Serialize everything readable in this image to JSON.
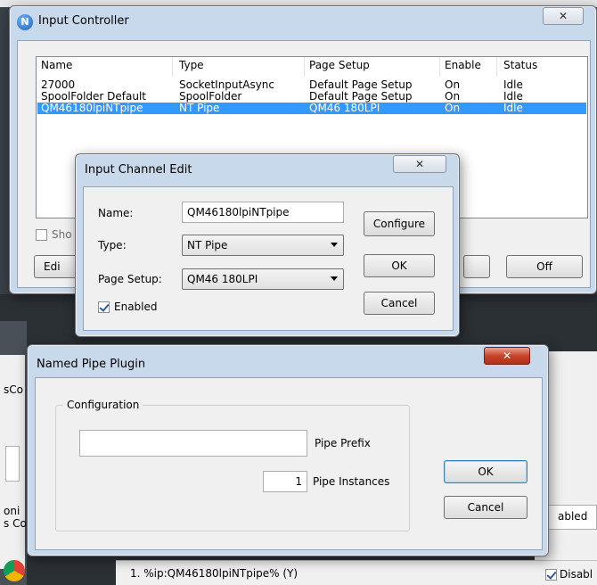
{
  "input_controller": {
    "title": "Input Controller",
    "columns": [
      "Name",
      "Type",
      "Page Setup",
      "Enable",
      "Status"
    ],
    "rows": [
      {
        "name": "27000",
        "type": "SocketInputAsync",
        "page_setup": "Default Page Setup",
        "enable": "On",
        "status": "Idle"
      },
      {
        "name": "SpoolFolder Default",
        "type": "SpoolFolder",
        "page_setup": "Default Page Setup",
        "enable": "On",
        "status": "Idle"
      },
      {
        "name": "QM46180lpiNTpipe",
        "type": "NT Pipe",
        "page_setup": "QM46 180LPI",
        "enable": "On",
        "status": "Idle",
        "selected": true
      }
    ],
    "show_label_partial": "Sho",
    "edit_label_partial": "Edi",
    "off_label": "Off"
  },
  "input_channel_edit": {
    "title": "Input Channel Edit",
    "name_label": "Name:",
    "name_value": "QM46180lpiNTpipe",
    "type_label": "Type:",
    "type_value": "NT Pipe",
    "page_setup_label": "Page Setup:",
    "page_setup_value": "QM46 180LPI",
    "enabled_label": "Enabled",
    "enabled_checked": true,
    "configure_label": "Configure",
    "ok_label": "OK",
    "cancel_label": "Cancel"
  },
  "named_pipe_plugin": {
    "title": "Named Pipe Plugin",
    "group_label": "Configuration",
    "pipe_prefix_value": "",
    "pipe_prefix_label": "Pipe Prefix",
    "pipe_instances_value": "1",
    "pipe_instances_label": "Pipe Instances",
    "ok_label": "OK",
    "cancel_label": "Cancel"
  },
  "background": {
    "left_fragments": [
      "sCo",
      "oni",
      "s Co"
    ],
    "bottom_text": "1. %ip:QM46180lpiNTpipe% (Y)",
    "right_abled": "abled",
    "disable_partial": "Disabl"
  },
  "close_glyph": "✕",
  "app_icon_letter": "N",
  "colors": {
    "selection": "#3399ff",
    "title_glass": "#c9d9ec",
    "close_red": "#c7442a"
  }
}
